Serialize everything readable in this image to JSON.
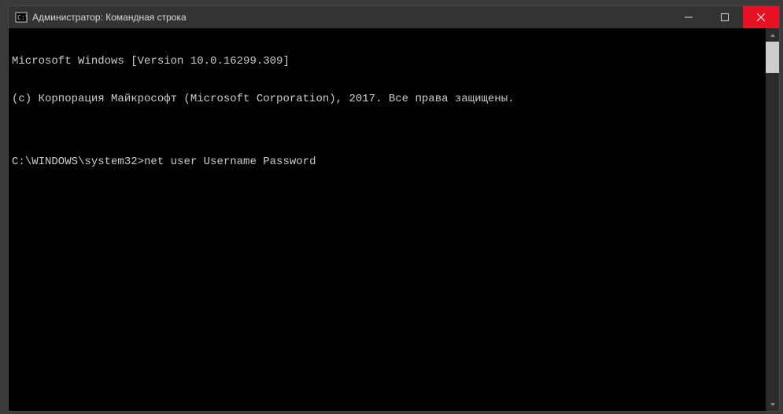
{
  "titlebar": {
    "title": "Администратор: Командная строка"
  },
  "terminal": {
    "line1": "Microsoft Windows [Version 10.0.16299.309]",
    "line2": "(c) Корпорация Майкрософт (Microsoft Corporation), 2017. Все права защищены.",
    "blank": "",
    "prompt": "C:\\WINDOWS\\system32>",
    "command": "net user Username Password"
  }
}
